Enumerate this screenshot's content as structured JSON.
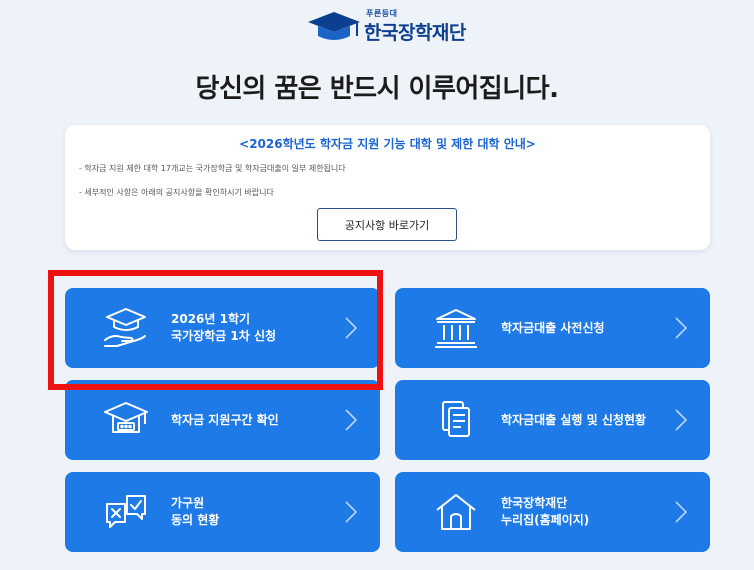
{
  "logo": {
    "small_text": "푸른등대",
    "name": "한국장학재단"
  },
  "headline": "당신의 꿈은 반드시 이루어집니다.",
  "notice": {
    "title": "<2026학년도 학자금 지원 기능 대학 및 제한 대학 안내>",
    "line1": "- 학자금 지원 제한 대학 17개교는 국가장학금 및 학자금대출이 일부 제한됩니다",
    "line2": "- 세부적인 사항은 아래의 공지사항을 확인하시기 바랍니다",
    "button_label": "공지사항 바로가기"
  },
  "tiles": [
    {
      "line1": "2026년 1학기",
      "line2": "국가장학금 1차 신청",
      "icon": "graduation-cap-hand-icon"
    },
    {
      "line1": "학자금대출 사전신청",
      "line2": "",
      "icon": "bank-icon"
    },
    {
      "line1": "학자금 지원구간 확인",
      "line2": "",
      "icon": "graduation-cap-icon"
    },
    {
      "line1": "학자금대출 실행 및 신청현황",
      "line2": "",
      "icon": "documents-icon"
    },
    {
      "line1": "가구원",
      "line2": "동의 현황",
      "icon": "consent-chat-icon"
    },
    {
      "line1": "한국장학재단",
      "line2": "누리집(홈페이지)",
      "icon": "home-icon"
    }
  ],
  "colors": {
    "tile": "#1e7ae6",
    "highlight": "#ee1111",
    "title_blue": "#1b64d1"
  }
}
